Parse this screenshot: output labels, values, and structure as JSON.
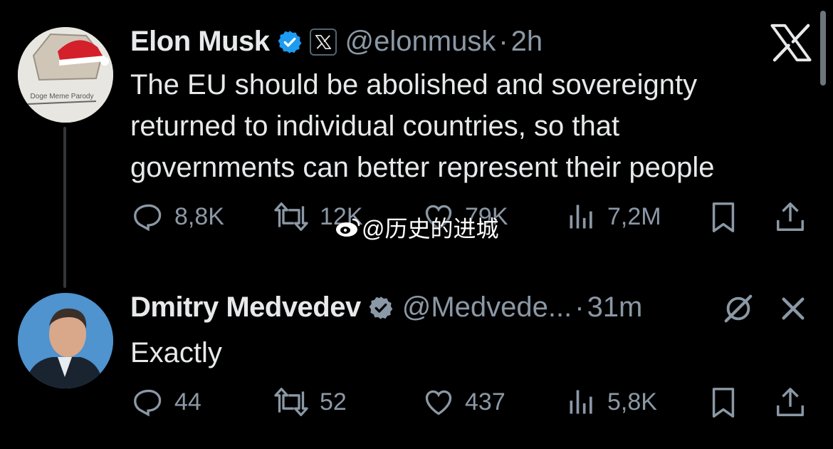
{
  "tweet1": {
    "name": "Elon Musk",
    "handle": "@elonmusk",
    "separator": "·",
    "time": "2h",
    "text_lines": [
      "The EU should be abolished and sovereignty",
      "returned to individual countries, so that",
      "governments can better represent their people"
    ],
    "replies": "8,8K",
    "reposts": "12K",
    "likes": "79K",
    "views": "7,2M"
  },
  "tweet2": {
    "name": "Dmitry Medvedev",
    "handle": "@Medvede...",
    "separator": "·",
    "time": "31m",
    "text": "Exactly",
    "replies": "44",
    "reposts": "52",
    "likes": "437",
    "views": "5,8K"
  },
  "avatar1_text": "Doge Meme Parody",
  "watermark": "@历史的进城",
  "colors": {
    "background": "#000000",
    "text": "#e7e9ea",
    "muted": "#8b98a5",
    "verified": "#1d9bf0"
  },
  "icons": [
    "reply-icon",
    "repost-icon",
    "like-icon",
    "views-icon",
    "bookmark-icon",
    "share-icon",
    "verified-icon",
    "x-logo-icon",
    "close-icon",
    "grok-icon"
  ]
}
